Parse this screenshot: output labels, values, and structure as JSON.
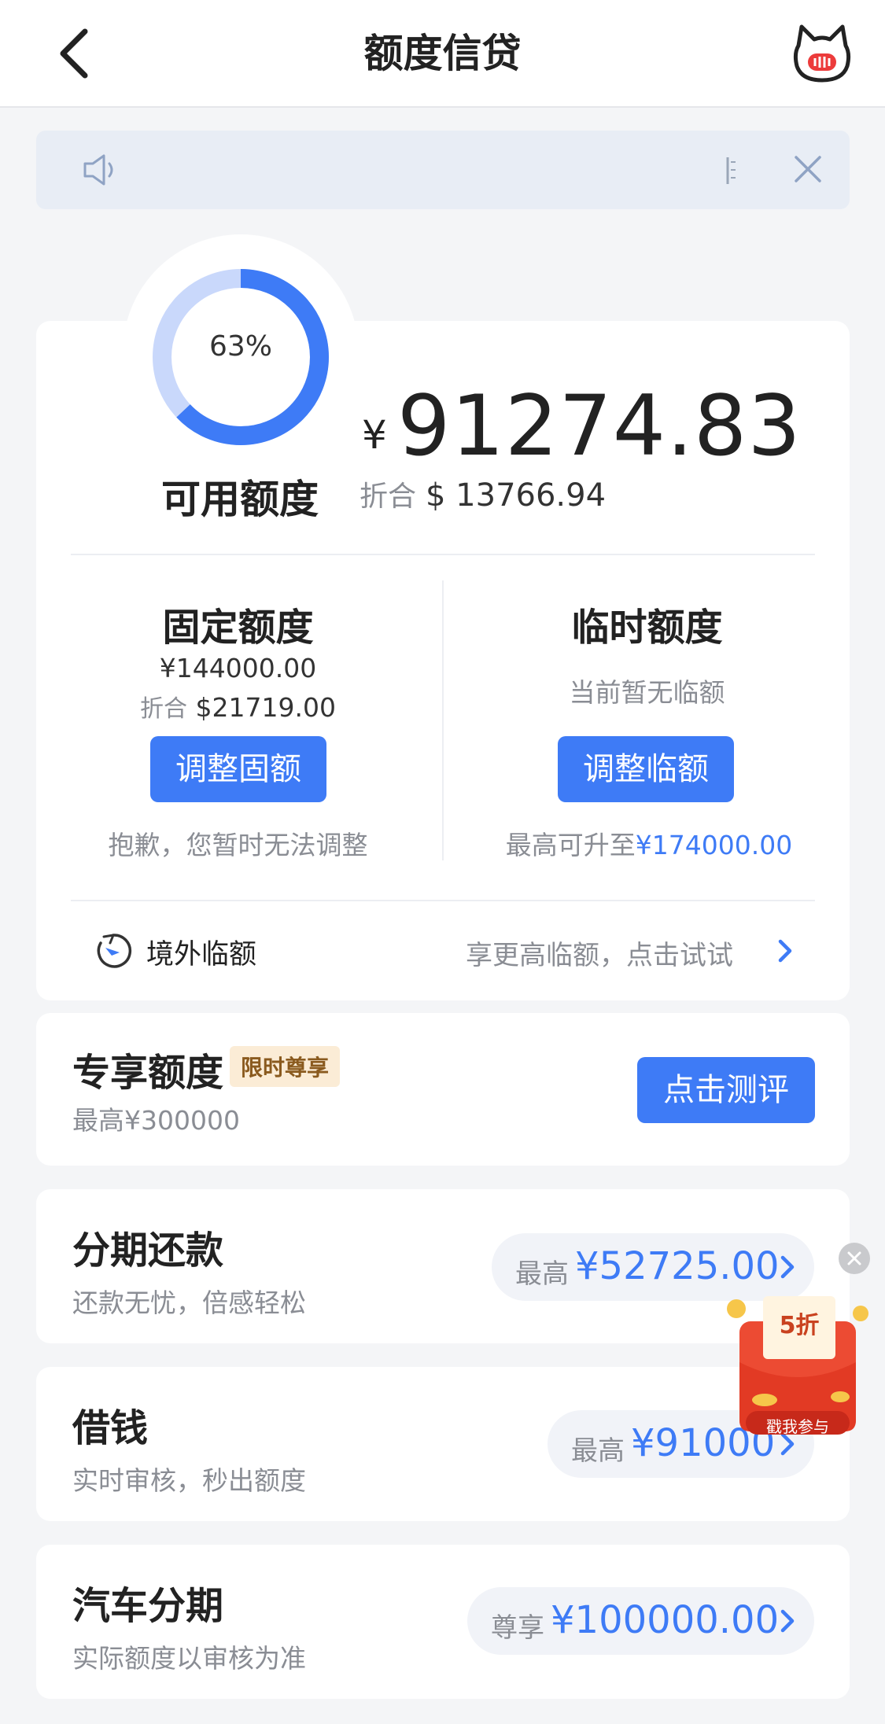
{
  "header": {
    "title": "额度信贷"
  },
  "credit": {
    "percent_text": "63%",
    "percent": 0.63,
    "available_label": "可用额度",
    "currency_symbol": "¥",
    "available_amount": "91274.83",
    "equiv_label": "折合",
    "equiv_amount": "$ 13766.94"
  },
  "fixed": {
    "title": "固定额度",
    "amount": "¥144000.00",
    "equiv_label": "折合",
    "equiv_amount": "$21719.00",
    "button": "调整固额",
    "note": "抱歉，您暂时无法调整"
  },
  "temp": {
    "title": "临时额度",
    "status": "当前暂无临额",
    "button": "调整临额",
    "note_prefix": "最高可升至",
    "note_amount": "¥174000.00"
  },
  "overseas": {
    "label": "境外临额",
    "hint": "享更高临额，点击试试"
  },
  "exclusive": {
    "title": "专享额度",
    "badge": "限时尊享",
    "sub": "最高¥300000",
    "button": "点击测评"
  },
  "installment": {
    "title": "分期还款",
    "sub": "还款无忧，倍感轻松",
    "pill_label": "最高",
    "pill_value": "¥52725.00"
  },
  "borrow": {
    "title": "借钱",
    "sub": "实时审核，秒出额度",
    "pill_label": "最高",
    "pill_value": "¥91000"
  },
  "car": {
    "title": "汽车分期",
    "sub": "实际额度以审核为准",
    "pill_label": "尊享",
    "pill_value": "¥100000.00"
  },
  "promo": {
    "discount": "5折",
    "cta": "戳我参与"
  },
  "colors": {
    "accent": "#3e7bf6",
    "ring_track": "#c9d8fb",
    "background": "#f4f5f7"
  },
  "icons": {
    "back": "chevron-left-icon",
    "mascot": "cat-mascot-icon",
    "speaker": "speaker-icon",
    "close": "close-icon",
    "overseas": "clock-plane-icon",
    "chevron": "chevron-right-icon"
  }
}
